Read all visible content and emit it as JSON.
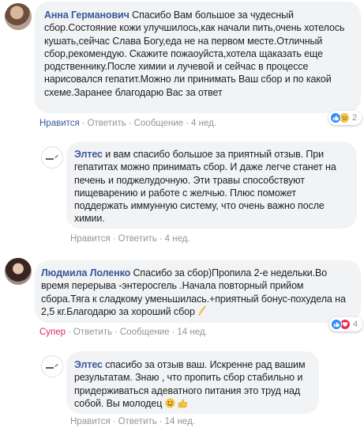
{
  "comments": [
    {
      "author": "Анна Германович",
      "text": "Спасибо Вам большое за чудесный сбор.Состояние кожи улучшилось,как начали пить,очень хотелось кушать,сейчас Слава Богу,еда не на первом месте.Отличный сбор,рекомендую. Скажите пожаоуйста,хотела щаказать еще родственнику.После химии и лучевой и сейчас в процессе нарисовался гепатит.Можно ли принимать Ваш сбор и по какой схеме.Заранее благодарю Вас за ответ",
      "actions": {
        "like": "Нравится",
        "reply": "Ответить",
        "message": "Сообщение",
        "time": "4 нед."
      },
      "reactions": {
        "icons": [
          "like-icon",
          "sad-icon"
        ],
        "count": "2"
      }
    },
    {
      "author": "Элтес",
      "text": "и вам спасибо большое за приятный отзыв. При гепатитах можно принимать сбор. И даже легче станет на печень и поджелудочную. Эти травы способствуют пищеварению и работе с желчью. Плюс поможет поддержать иммунную систему, что очень важно после химии.",
      "actions": {
        "like": "Нравится",
        "reply": "Ответить",
        "time": "4 нед."
      }
    },
    {
      "author": "Людмила Лоленко",
      "text": "Спасибо за сбор)Пропила 2-е недельки.Во время перерыва -энтеросгель .Начала повторный прийом сбора.Тяга к сладкому уменьшилась.+приятный бонус-похудела на 2,5 кг.Благодарю за хороший сбор",
      "actions": {
        "like": "Супер",
        "reply": "Ответить",
        "message": "Сообщение",
        "time": "14 нед."
      },
      "reactions": {
        "icons": [
          "like-icon",
          "love-icon"
        ],
        "count": "4"
      }
    },
    {
      "author": "Элтес",
      "text": "спасибо за отзыв ваш. Искренне рад вашим результатам. Знаю , что пропить сбор стабильно и придерживаться адеватного питания это труд над собой. Вы молодец",
      "actions": {
        "like": "Нравится",
        "reply": "Ответить",
        "time": "14 нед."
      }
    }
  ],
  "colors": {
    "link": "#385898",
    "meta": "#90949c",
    "bubble": "#f2f3f5",
    "super": "#e0245e"
  }
}
